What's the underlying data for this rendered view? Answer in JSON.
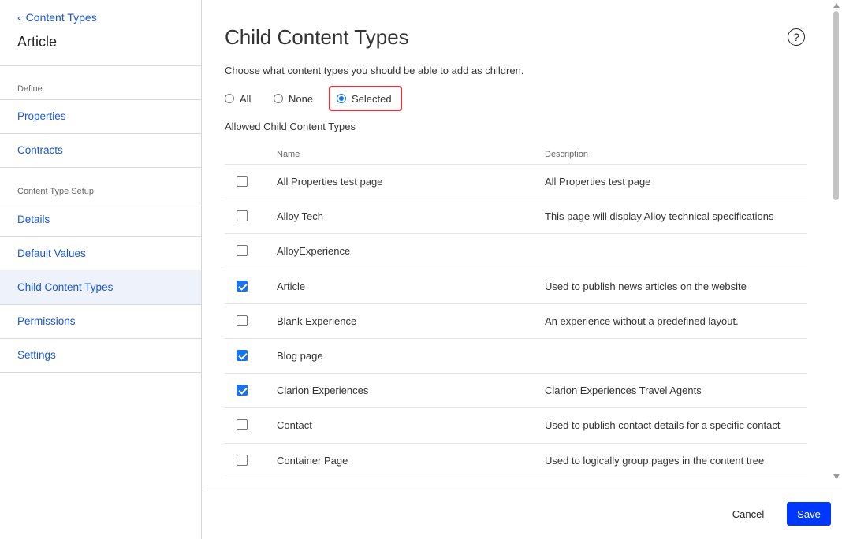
{
  "sidebar": {
    "back_label": "Content Types",
    "title": "Article",
    "section_define": "Define",
    "section_setup": "Content Type Setup",
    "items": [
      {
        "label": "Properties"
      },
      {
        "label": "Contracts"
      },
      {
        "label": "Details"
      },
      {
        "label": "Default Values"
      },
      {
        "label": "Child Content Types",
        "active": true
      },
      {
        "label": "Permissions"
      },
      {
        "label": "Settings"
      }
    ]
  },
  "main": {
    "title": "Child Content Types",
    "help_glyph": "?",
    "subtitle": "Choose what content types you should be able to add as children.",
    "radio": {
      "options": [
        "All",
        "None",
        "Selected"
      ],
      "selected": "Selected"
    },
    "section_label": "Allowed Child Content Types",
    "table": {
      "headers": {
        "name": "Name",
        "description": "Description"
      },
      "rows": [
        {
          "checked": false,
          "name": "All Properties test page",
          "description": "All Properties test page"
        },
        {
          "checked": false,
          "name": "Alloy Tech",
          "description": "This page will display Alloy technical specifications"
        },
        {
          "checked": false,
          "name": "AlloyExperience",
          "description": ""
        },
        {
          "checked": true,
          "name": "Article",
          "description": "Used to publish news articles on the website"
        },
        {
          "checked": false,
          "name": "Blank Experience",
          "description": "An experience without a predefined layout."
        },
        {
          "checked": true,
          "name": "Blog page",
          "description": ""
        },
        {
          "checked": true,
          "name": "Clarion Experiences",
          "description": "Clarion Experiences Travel Agents"
        },
        {
          "checked": false,
          "name": "Contact",
          "description": "Used to publish contact details for a specific contact"
        },
        {
          "checked": false,
          "name": "Container Page",
          "description": "Used to logically group pages in the content tree"
        }
      ]
    }
  },
  "footer": {
    "cancel_label": "Cancel",
    "save_label": "Save"
  },
  "colors": {
    "accent": "#1a73e8",
    "link": "#1a56db",
    "save_button": "#0037ff",
    "highlight": "#d9363e",
    "active_bg": "#eef2fa"
  }
}
